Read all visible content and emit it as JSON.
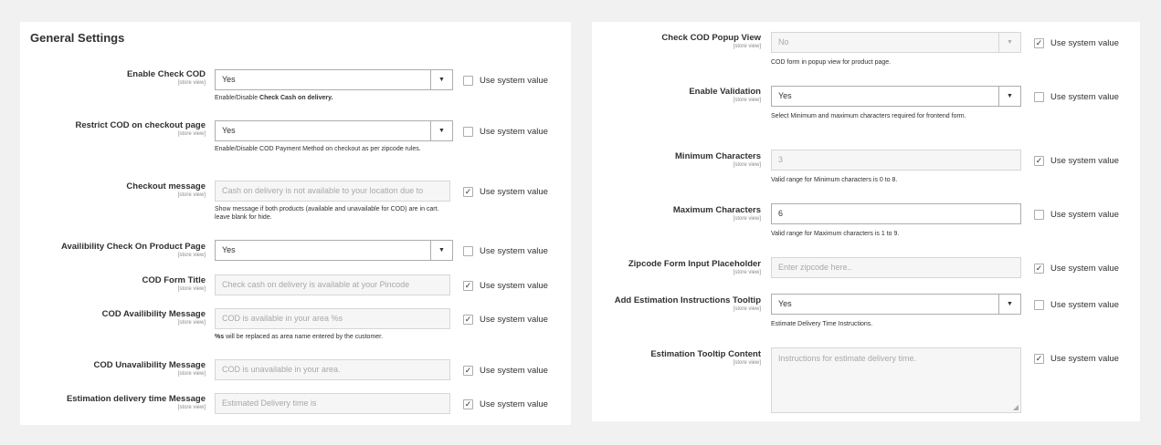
{
  "general_settings_title": "General Settings",
  "system_value_label": "Use system value",
  "store_view_label": "[store view]",
  "left_fields": [
    {
      "label": "Enable Check COD",
      "value": "Yes",
      "note_pre": "Enable/Disable ",
      "note_bold": "Check Cash on delivery.",
      "use_system": false
    },
    {
      "label": "Restrict COD on checkout page",
      "value": "Yes",
      "note": "Enable/Disable COD Payment Method on checkout as per zipcode rules.",
      "use_system": false
    },
    {
      "label": "Checkout message",
      "value": "Cash on delivery is not available to your location due to",
      "note": "Show message if both products (available and unavailable for COD) are in cart. leave blank for hide.",
      "use_system": true
    },
    {
      "label": "Availibility Check On Product Page",
      "value": "Yes",
      "use_system": false
    },
    {
      "label": "COD Form Title",
      "value": "Check cash on delivery is available at your Pincode",
      "use_system": true
    },
    {
      "label": "COD Availibility Message",
      "value": "COD is available in your area %s",
      "note_bold": "%s",
      "note_post": " will be replaced as area name entered by the customer.",
      "use_system": true
    },
    {
      "label": "COD Unavalibility Message",
      "value": "COD is unavailable in your area.",
      "use_system": true
    },
    {
      "label": "Estimation delivery time Message",
      "value": "Estimated Delivery time is",
      "use_system": true
    }
  ],
  "right_fields": [
    {
      "label": "Check COD Popup View",
      "value": "No",
      "note": "COD form in popup view for product page.",
      "use_system": true
    },
    {
      "label": "Enable Validation",
      "value": "Yes",
      "note": "Select Minimum and maximum characters required for frontend form.",
      "use_system": false
    },
    {
      "label": "Minimum Characters",
      "value": "3",
      "note": "Valid range for Minimum characters is 0 to 8.",
      "use_system": true
    },
    {
      "label": "Maximum Characters",
      "value": "6",
      "note": "Valid range for Maximum characters is 1 to 9.",
      "use_system": false
    },
    {
      "label": "Zipcode Form Input Placeholder",
      "value": "Enter zipcode here..",
      "use_system": true
    },
    {
      "label": "Add Estimation Instructions Tooltip",
      "value": "Yes",
      "note": "Estimate Delivery Time Instructions.",
      "use_system": false
    },
    {
      "label": "Estimation Tooltip Content",
      "value": "Instructions for estimate delivery time.",
      "use_system": true
    }
  ],
  "icons": {
    "checkbox_checked": "checkmark-icon",
    "dropdown": "caret-down-icon",
    "resize": "resize-grip-icon"
  }
}
